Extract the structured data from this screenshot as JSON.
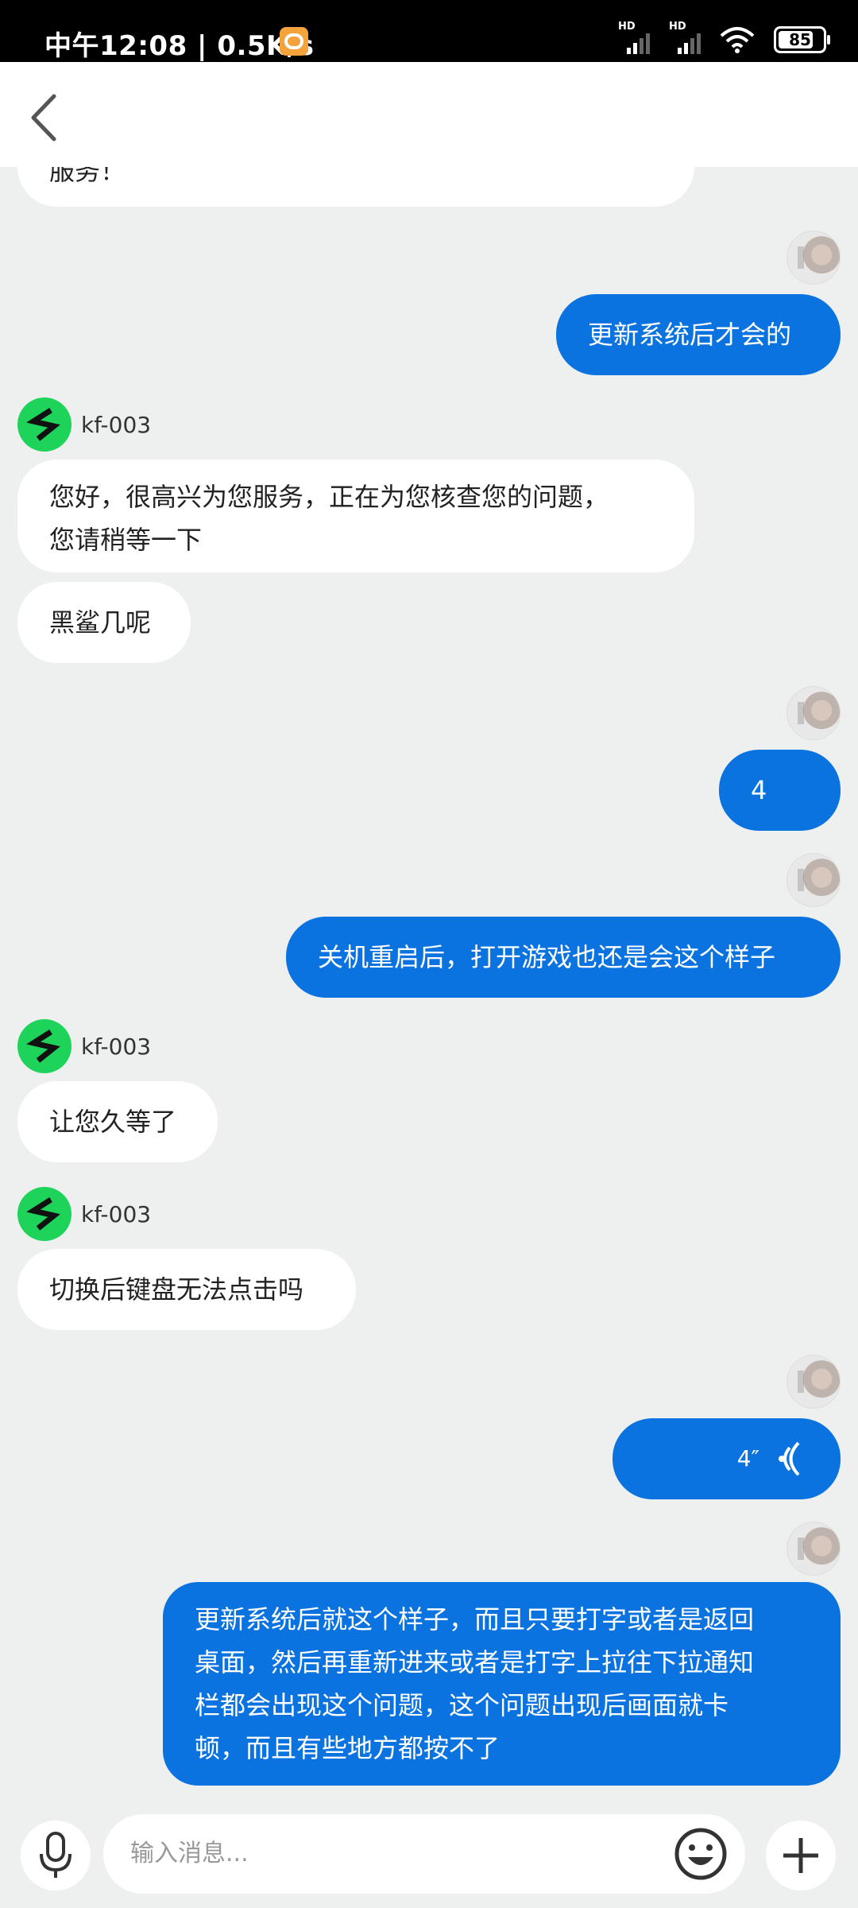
{
  "status_bar": {
    "time_text": "中午12:08 | 0.5K/s",
    "signal1_label": "HD",
    "signal2_label": "HD",
    "battery": "85"
  },
  "header": {
    "back_icon": "chevron-left-icon"
  },
  "messages": {
    "m0_text": "服务！",
    "m1_text": "更新系统后才会的",
    "agent1_name": "kf-003",
    "m2_text": "您好，很高兴为您服务，正在为您核查您的问题，\n您请稍等一下",
    "m3_text": "黑鲨几呢",
    "m4_text": "4",
    "m5_text": "关机重启后，打开游戏也还是会这个样子",
    "agent2_name": "kf-003",
    "m6_text": "让您久等了",
    "agent3_name": "kf-003",
    "m7_text": "切换后键盘无法点击吗",
    "m8_voice_duration": "4″",
    "m9_text": "更新系统后就这个样子，而且只要打字或者是返回\n桌面，然后再重新进来或者是打字上拉往下拉通知\n栏都会出现这个问题，这个问题出现后画面就卡\n顿，而且有些地方都按不了"
  },
  "input": {
    "placeholder": "输入消息..."
  },
  "colors": {
    "accent_blue": "#0a73e0",
    "agent_green": "#1dd35a",
    "background": "#eef0f0"
  }
}
